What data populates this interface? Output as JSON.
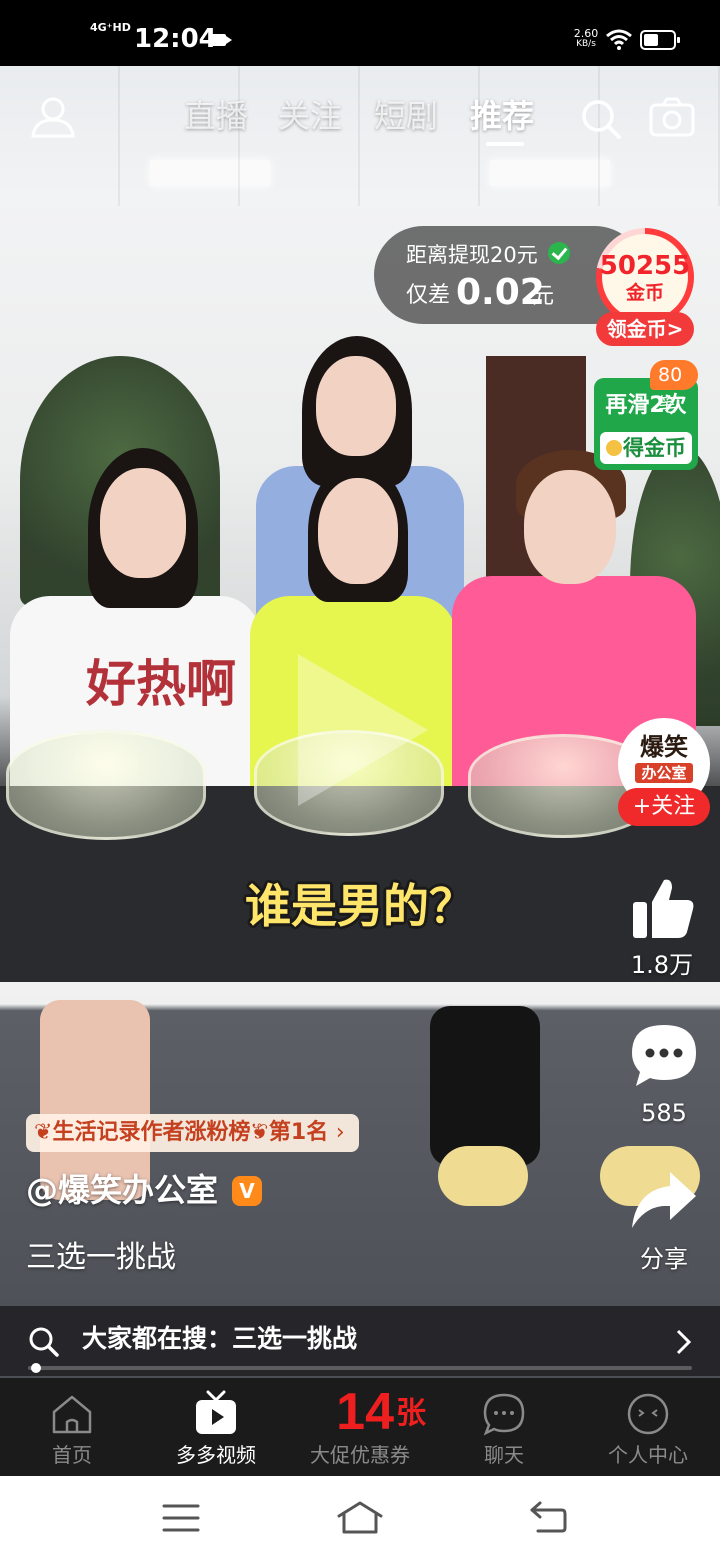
{
  "status_bar": {
    "network": "4G⁺HD",
    "time": "12:04",
    "speed_value": "2.60",
    "speed_unit": "KB/s"
  },
  "top_nav": {
    "tabs": [
      {
        "label": "直播",
        "active": false
      },
      {
        "label": "关注",
        "active": false
      },
      {
        "label": "短剧",
        "active": false
      },
      {
        "label": "推荐",
        "active": true
      }
    ]
  },
  "reward": {
    "cash_line1": "距离提现20元",
    "cash_prefix": "仅差",
    "cash_amount": "0.02",
    "cash_unit": "元",
    "coins": "50255",
    "coins_unit": "金币",
    "collect_label": "领金币>",
    "swipe_badge": "80笔",
    "swipe_text": "再滑2次",
    "swipe_button": "得金币",
    "progress_fraction": 0.78
  },
  "video": {
    "subtitle": "谁是男的？"
  },
  "right_rail": {
    "avatar_line1": "爆笑",
    "avatar_line2": "办公室",
    "follow_label": "+关注",
    "likes": "1.8万",
    "comments": "585",
    "share_label": "分享"
  },
  "info": {
    "rank_tag": "生活记录作者涨粉榜",
    "rank_position": "第1名",
    "author": "@爆笑办公室",
    "verified_badge": "V",
    "caption": "三选一挑战"
  },
  "search_bar": {
    "text": "大家都在搜：三选一挑战"
  },
  "playback_progress": 0.01,
  "tab_bar": {
    "items": [
      {
        "label": "首页",
        "icon": "home-icon",
        "active": false
      },
      {
        "label": "多多视频",
        "icon": "video-tv-icon",
        "active": true
      },
      {
        "label": "大促优惠券",
        "icon": "coupon",
        "active": false
      },
      {
        "label": "聊天",
        "icon": "chat-icon",
        "active": false
      },
      {
        "label": "个人中心",
        "icon": "profile-icon",
        "active": false
      }
    ],
    "coupon_count": "14",
    "coupon_unit": "张"
  },
  "colors": {
    "accent_red": "#ef1f1f",
    "subtitle_yellow": "#ffe56a",
    "swipe_green": "#1fa74a"
  }
}
